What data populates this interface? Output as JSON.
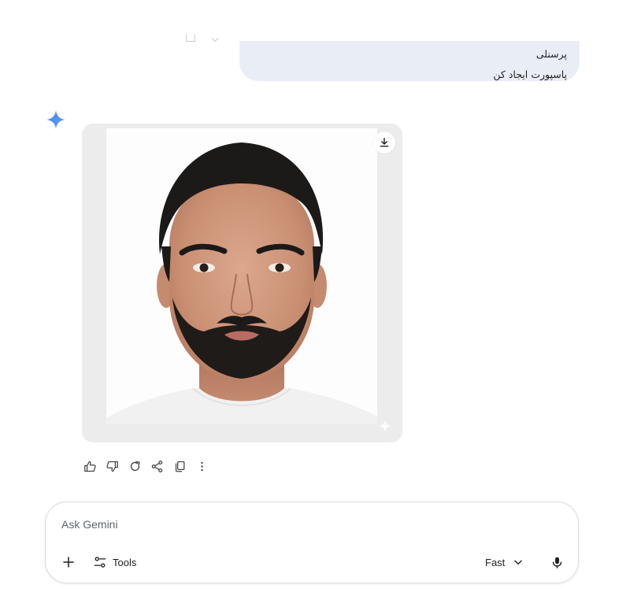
{
  "conversation": {
    "user_message": {
      "line1": "یک عکس پرسنلی از این تصویر برای پاسپورت با رعایت تمام قوانین عکس پرسنلی",
      "line2": "پاسپورت ایجاد کن"
    },
    "response": {
      "image_alt": "passport-photo",
      "actions": [
        {
          "name": "thumbs-up-icon"
        },
        {
          "name": "thumbs-down-icon"
        },
        {
          "name": "redo-icon"
        },
        {
          "name": "share-icon"
        },
        {
          "name": "copy-icon"
        },
        {
          "name": "more-vert-icon"
        }
      ]
    }
  },
  "input": {
    "placeholder": "Ask Gemini",
    "value": "",
    "tools_label": "Tools",
    "mode_label": "Fast"
  },
  "colors": {
    "bubble_bg": "#e9eef6",
    "card_bg": "#ececec",
    "spark_blue": "#4a8af4",
    "icon": "#444746"
  }
}
